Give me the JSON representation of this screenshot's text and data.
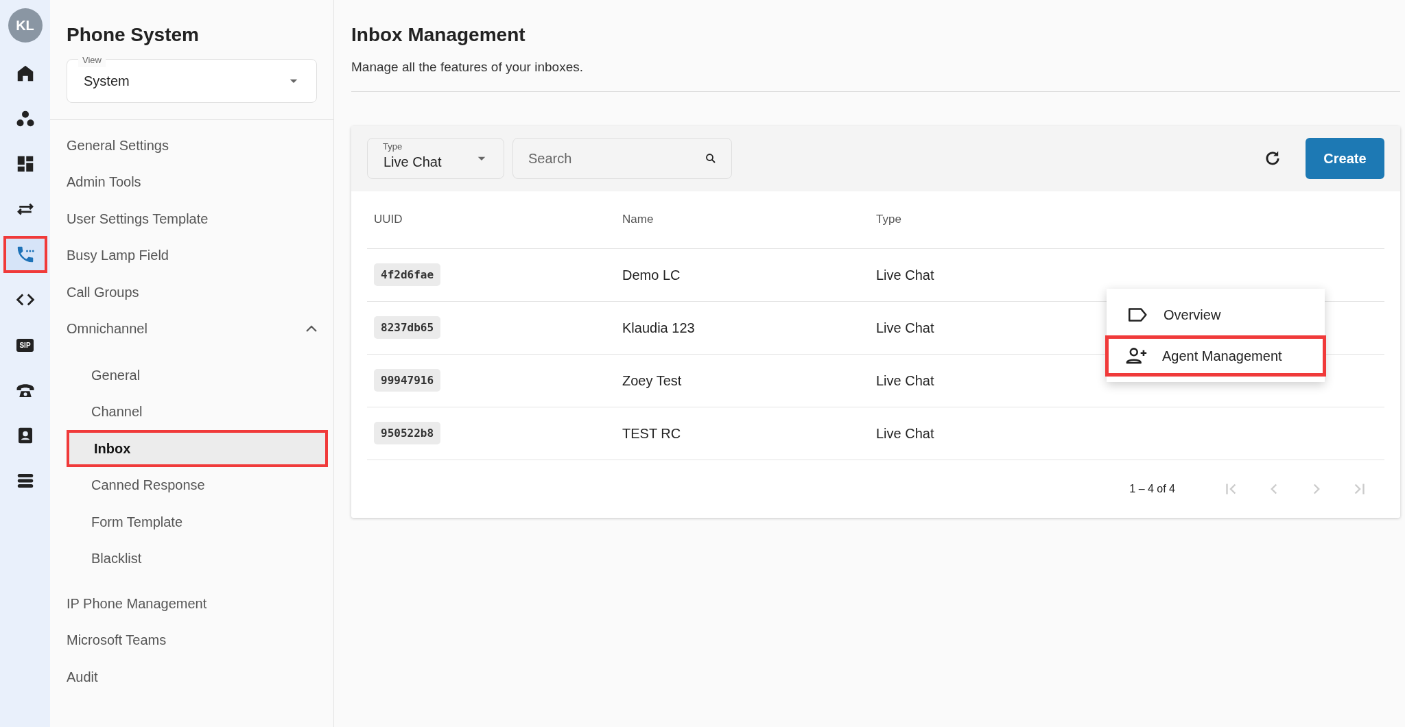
{
  "rail": {
    "avatar": "KL",
    "items": [
      {
        "selected": false,
        "highlighted": false
      },
      {
        "selected": false,
        "highlighted": false
      },
      {
        "selected": false,
        "highlighted": false
      },
      {
        "selected": false,
        "highlighted": false
      },
      {
        "selected": true,
        "highlighted": true
      },
      {
        "selected": false,
        "highlighted": false
      },
      {
        "label": "SIP",
        "selected": false,
        "highlighted": false
      },
      {
        "selected": false,
        "highlighted": false
      },
      {
        "selected": false,
        "highlighted": false
      },
      {
        "selected": false,
        "highlighted": false
      }
    ]
  },
  "sidebar": {
    "title": "Phone System",
    "view_select": {
      "label": "View",
      "value": "System"
    },
    "items": [
      {
        "label": "General Settings",
        "selected": false,
        "highlighted": false
      },
      {
        "label": "Admin Tools",
        "selected": false,
        "highlighted": false
      },
      {
        "label": "User Settings Template",
        "selected": false,
        "highlighted": false
      },
      {
        "label": "Busy Lamp Field",
        "selected": false,
        "highlighted": false
      },
      {
        "label": "Call Groups",
        "selected": false,
        "highlighted": false
      },
      {
        "label": "Omnichannel",
        "selected": false,
        "highlighted": false,
        "expanded": true,
        "children": [
          {
            "label": "General",
            "selected": false,
            "highlighted": false
          },
          {
            "label": "Channel",
            "selected": false,
            "highlighted": false
          },
          {
            "label": "Inbox",
            "selected": true,
            "highlighted": true
          },
          {
            "label": "Canned Response",
            "selected": false,
            "highlighted": false
          },
          {
            "label": "Form Template",
            "selected": false,
            "highlighted": false
          },
          {
            "label": "Blacklist",
            "selected": false,
            "highlighted": false
          }
        ]
      },
      {
        "label": "IP Phone Management",
        "selected": false,
        "highlighted": false
      },
      {
        "label": "Microsoft Teams",
        "selected": false,
        "highlighted": false
      },
      {
        "label": "Audit",
        "selected": false,
        "highlighted": false
      }
    ]
  },
  "page": {
    "title": "Inbox Management",
    "subtitle": "Manage all the features of your inboxes."
  },
  "toolbar": {
    "type_select": {
      "label": "Type",
      "value": "Live Chat"
    },
    "search": {
      "placeholder": "Search"
    },
    "create_button": "Create"
  },
  "table": {
    "columns": [
      "UUID",
      "Name",
      "Type"
    ],
    "rows": [
      [
        "4f2d6fae",
        "Demo LC",
        "Live Chat"
      ],
      [
        "8237db65",
        "Klaudia 123",
        "Live Chat"
      ],
      [
        "99947916",
        "Zoey Test",
        "Live Chat"
      ],
      [
        "950522b8",
        "TEST RC",
        "Live Chat"
      ]
    ]
  },
  "pagination": {
    "range": "1 – 4 of 4"
  },
  "context_menu": {
    "items": [
      {
        "label": "Overview",
        "highlighted": false
      },
      {
        "label": "Agent Management",
        "highlighted": true
      }
    ]
  }
}
